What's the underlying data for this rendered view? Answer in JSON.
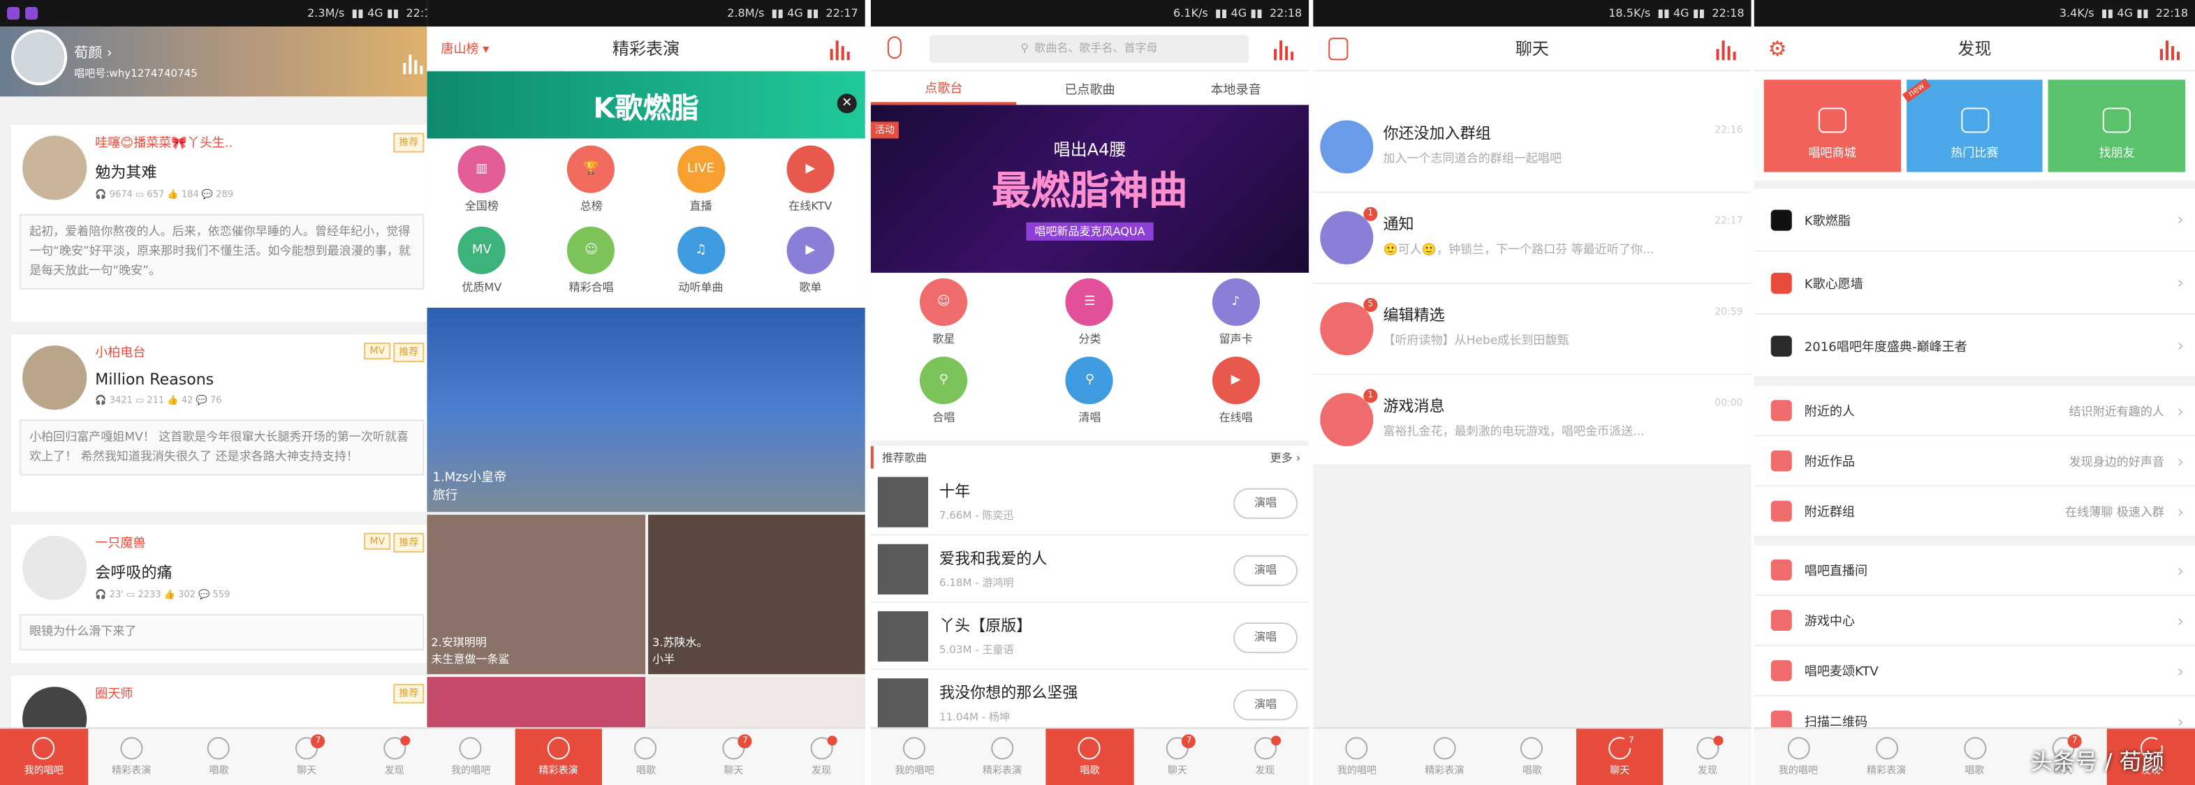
{
  "status_bars": [
    {
      "speed": "2.3M/s",
      "time": "22:1"
    },
    {
      "speed": "2.8M/s",
      "time": "22:17"
    },
    {
      "speed": "6.1K/s",
      "time": "22:18"
    },
    {
      "speed": "18.5K/s",
      "time": "22:18"
    },
    {
      "speed": "3.4K/s",
      "time": "22:18"
    }
  ],
  "tabs": [
    "我的唱吧",
    "精彩表演",
    "唱歌",
    "聊天",
    "发现"
  ],
  "tab_badge": "7",
  "profile": {
    "name": "荀颜 ›",
    "id": "唱吧号:why1274740745"
  },
  "feed": [
    {
      "user": "哇噻😊播菜菜🎀丫头生..",
      "song": "勉为其难",
      "stats": "🎧 9674  ▭ 657  👍 184  💬 289",
      "tags": [
        "推荐"
      ],
      "quote": "起初，爱着陪你熬夜的人。后来，依恋催你早睡的人。曾经年纪小，觉得一句“晚安”好平淡，原来那时我们不懂生活。如今能想到最浪漫的事，就是每天放此一句“晚安”。"
    },
    {
      "user": "小柏电台",
      "song": "Million Reasons",
      "stats": "🎧 3421  ▭ 211  👍 42  💬 76",
      "tags": [
        "MV",
        "推荐"
      ],
      "quote": "小柏回归富产嘎姐MV！ 这首歌是今年很窜大长腿秀开场的第一次听就喜欢上了！ 希然我知道我消失很久了 还是求各路大神支持支持！"
    },
    {
      "user": "一只魔兽",
      "song": "会呼吸的痛",
      "stats": "🎧 23'  ▭ 2233  👍 302  💬 559",
      "tags": [
        "MV",
        "推荐"
      ],
      "quote": "眼镜为什么滑下来了"
    },
    {
      "user": "圈天师",
      "song": "",
      "stats": "",
      "tags": [
        "推荐"
      ],
      "quote": ""
    }
  ],
  "perform": {
    "city": "唐山榜 ▾",
    "title": "精彩表演",
    "banner_text": "K歌燃脂",
    "banner_close": "✕",
    "grid": [
      {
        "label": "全国榜",
        "color": "#e25d96",
        "glyph": "▥"
      },
      {
        "label": "总榜",
        "color": "#f06b5d",
        "glyph": "🏆"
      },
      {
        "label": "直播",
        "color": "#f7a030",
        "glyph": "LIVE"
      },
      {
        "label": "在线KTV",
        "color": "#e8584d",
        "glyph": "▶"
      },
      {
        "label": "优质MV",
        "color": "#3cb37a",
        "glyph": "MV"
      },
      {
        "label": "精彩合唱",
        "color": "#7cc35a",
        "glyph": "☺"
      },
      {
        "label": "动听单曲",
        "color": "#3f9be0",
        "glyph": "♫"
      },
      {
        "label": "歌单",
        "color": "#8a7fd6",
        "glyph": "▶"
      }
    ],
    "feature": {
      "rank": "1.Mzs小皇帝",
      "desc": "旅行"
    },
    "tiles": [
      {
        "rank": "2.安琪明明",
        "desc": "未生意做一条鲨"
      },
      {
        "rank": "3.苏陕水。",
        "desc": "小半"
      }
    ]
  },
  "sing": {
    "search_placeholder": "歌曲名、歌手名、首字母",
    "subtabs": [
      "点歌台",
      "已点歌曲",
      "本地录音"
    ],
    "promo_label": "活动",
    "promo_title": "最燃脂神曲",
    "promo_head": "唱出A4腰",
    "promo_sub": "唱吧新品麦克风AQUA",
    "grid": [
      {
        "label": "歌星",
        "color": "#f06b6b",
        "glyph": "☺"
      },
      {
        "label": "分类",
        "color": "#e2509a",
        "glyph": "☰"
      },
      {
        "label": "留声卡",
        "color": "#8a7fd6",
        "glyph": "♪"
      },
      {
        "label": "合唱",
        "color": "#7cc35a",
        "glyph": "⚲"
      },
      {
        "label": "清唱",
        "color": "#3f9be0",
        "glyph": "⚲"
      },
      {
        "label": "在线唱",
        "color": "#e8584d",
        "glyph": "▶"
      }
    ],
    "section": "推荐歌曲",
    "more": "更多 ›",
    "sing_label": "演唱",
    "songs": [
      {
        "name": "十年",
        "meta": "7.66M - 陈奕迅"
      },
      {
        "name": "爱我和我爱的人",
        "meta": "6.18M - 游鸿明"
      },
      {
        "name": "丫头【原版】",
        "meta": "5.03M - 王童语"
      },
      {
        "name": "我没你想的那么坚强",
        "meta": "11.04M - 杨坤"
      }
    ]
  },
  "chat": {
    "title": "聊天",
    "items": [
      {
        "name": "你还没加入群组",
        "msg": "加入一个志同道合的群组一起唱吧",
        "time": "22:16",
        "color": "#6a9be8",
        "badge": ""
      },
      {
        "name": "通知",
        "msg": "🙂可人🙂，钟锁兰，下一个路口芬 等最近听了你...",
        "time": "22:17",
        "color": "#8a7fd6",
        "badge": "1"
      },
      {
        "name": "编辑精选",
        "msg": "【听府读物】从Hebe成长到田馥甄",
        "time": "20:59",
        "color": "#f06b6b",
        "badge": "5"
      },
      {
        "name": "游戏消息",
        "msg": "富裕扎金花，最刺激的电玩游戏，唱吧金币派送...",
        "time": "00:00",
        "color": "#f06b6b",
        "badge": "1"
      }
    ]
  },
  "discover": {
    "title": "发现",
    "tiles": [
      {
        "label": "唱吧商城",
        "color": "#f0625a"
      },
      {
        "label": "热门比赛",
        "color": "#4aa8e8",
        "new": "new"
      },
      {
        "label": "找朋友",
        "color": "#5ac26a"
      }
    ],
    "groups": [
      [
        {
          "label": "K歌燃脂",
          "color": "#111",
          "desc": ""
        },
        {
          "label": "K歌心愿墙",
          "color": "#e74c3c",
          "desc": ""
        },
        {
          "label": "2016唱吧年度盛典-巅峰王者",
          "color": "#2a2a2a",
          "desc": ""
        }
      ],
      [
        {
          "label": "附近的人",
          "color": "#f06b6b",
          "desc": "结识附近有趣的人"
        },
        {
          "label": "附近作品",
          "color": "#f06b6b",
          "desc": "发现身边的好声音"
        },
        {
          "label": "附近群组",
          "color": "#f06b6b",
          "desc": "在线薄聊 极速入群"
        }
      ],
      [
        {
          "label": "唱吧直播间",
          "color": "#f06b6b",
          "desc": ""
        },
        {
          "label": "游戏中心",
          "color": "#f06b6b",
          "desc": ""
        },
        {
          "label": "唱吧麦颂KTV",
          "color": "#f06b6b",
          "desc": ""
        },
        {
          "label": "扫描二维码",
          "color": "#f06b6b",
          "desc": ""
        }
      ]
    ]
  },
  "watermark": "头条号 / 荀颜"
}
